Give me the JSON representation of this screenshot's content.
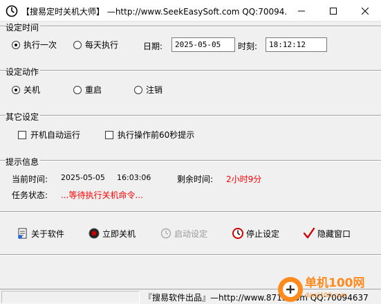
{
  "window": {
    "title": "【搜易定时关机大师】  —http://www.SeekEasySoft.com QQ:70094...",
    "minimize_icon": "minimize-icon",
    "maximize_icon": "maximize-icon",
    "close_icon": "close-icon"
  },
  "set_time": {
    "group_label": "设定时间",
    "radio_once": "执行一次",
    "radio_daily": "每天执行",
    "selected": "once",
    "date_label": "日期:",
    "date_value": "2025-05-05",
    "time_label": "时刻:",
    "time_value": "18:12:12"
  },
  "set_action": {
    "group_label": "设定动作",
    "options": [
      "关机",
      "重启",
      "注销"
    ],
    "selected": "关机"
  },
  "other": {
    "group_label": "其它设定",
    "autostart_label": "开机自动运行",
    "autostart_checked": false,
    "prompt_label": "执行操作前60秒提示",
    "prompt_checked": false
  },
  "info": {
    "group_label": "提示信息",
    "current_time_label": "当前时间:",
    "current_date": "2025-05-05",
    "current_time": "16:03:06",
    "remaining_label": "剩余时间:",
    "remaining_value": "2小时9分",
    "status_label": "任务状态:",
    "status_value": "...等待执行关机命令..."
  },
  "actions": {
    "about": "关于软件",
    "shutdown_now": "立即关机",
    "start": "启动设定",
    "stop": "停止设定",
    "hide": "隐藏窗口"
  },
  "statusbar": {
    "text": "『搜易软件出品』—http://www.8715.com  QQ:70094637"
  },
  "watermark": {
    "text": "单机100网",
    "sub": "danji100.com"
  },
  "colors": {
    "red_text": "#ff0000",
    "watermark": "#ff8a1e"
  }
}
